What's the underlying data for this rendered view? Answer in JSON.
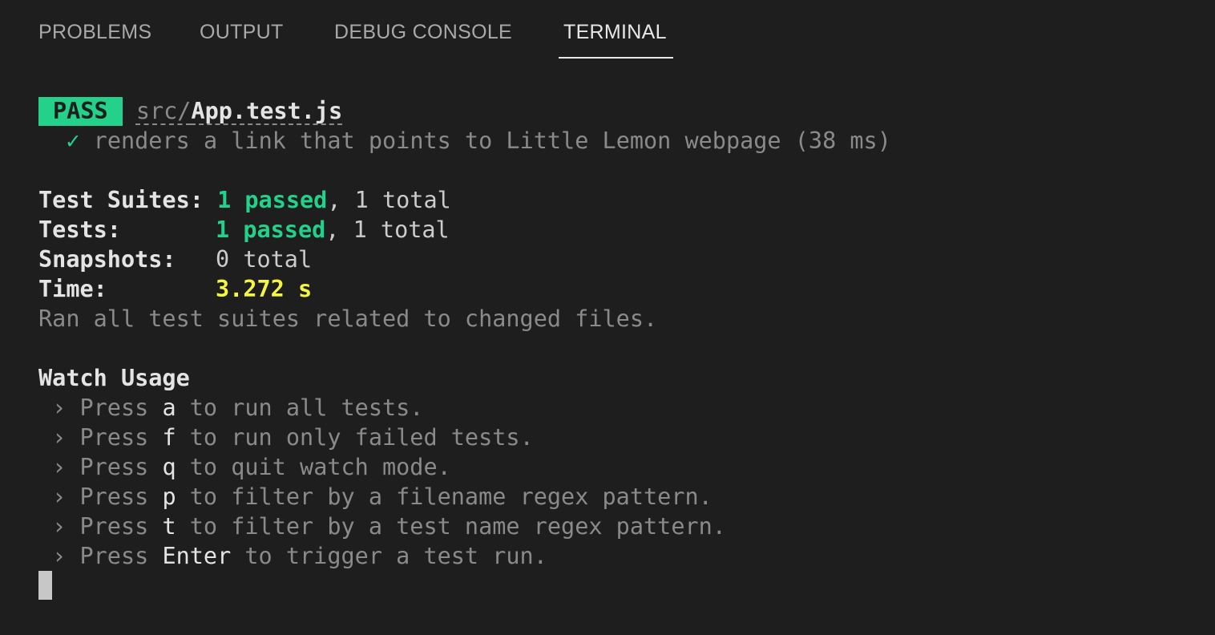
{
  "tabs": [
    {
      "label": "PROBLEMS"
    },
    {
      "label": "OUTPUT"
    },
    {
      "label": "DEBUG CONSOLE"
    },
    {
      "label": "TERMINAL"
    }
  ],
  "active_tab": "TERMINAL",
  "result": {
    "badge": "PASS",
    "path_dir": "src/",
    "path_file": "App.test.js",
    "check": "✓",
    "test_name": "renders a link that points to Little Lemon webpage (38 ms)"
  },
  "summary": {
    "suites_label": "Test Suites:",
    "suites_passed": "1 passed",
    "suites_total": ", 1 total",
    "tests_label": "Tests:",
    "tests_passed": "1 passed",
    "tests_total": ", 1 total",
    "snapshots_label": "Snapshots:",
    "snapshots_value": "0 total",
    "time_label": "Time:",
    "time_value": "3.272 s",
    "ran_note": "Ran all test suites related to changed files."
  },
  "watch": {
    "title": "Watch Usage",
    "items": [
      {
        "prefix": " › Press ",
        "key": "a",
        "suffix": " to run all tests."
      },
      {
        "prefix": " › Press ",
        "key": "f",
        "suffix": " to run only failed tests."
      },
      {
        "prefix": " › Press ",
        "key": "q",
        "suffix": " to quit watch mode."
      },
      {
        "prefix": " › Press ",
        "key": "p",
        "suffix": " to filter by a filename regex pattern."
      },
      {
        "prefix": " › Press ",
        "key": "t",
        "suffix": " to filter by a test name regex pattern."
      },
      {
        "prefix": " › Press ",
        "key": "Enter",
        "suffix": " to trigger a test run."
      }
    ]
  },
  "colors": {
    "background": "#1e1e1e",
    "pass_green": "#23d18b",
    "time_yellow": "#f5f543"
  }
}
